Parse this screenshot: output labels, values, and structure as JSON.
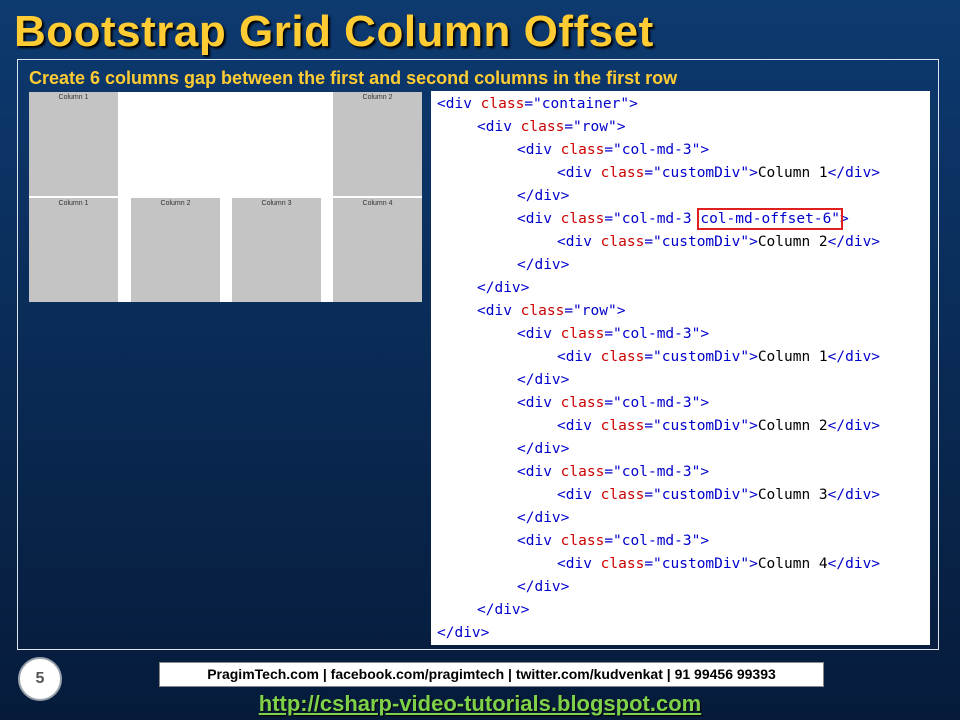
{
  "slide": {
    "title": "Bootstrap Grid Column Offset",
    "subtitle": "Create 6 columns gap between the first and second columns in the first row",
    "number": "5"
  },
  "demo": {
    "row1": [
      "Column 1",
      "Column 2"
    ],
    "row2": [
      "Column 1",
      "Column 2",
      "Column 3",
      "Column 4"
    ]
  },
  "code": {
    "lines": [
      {
        "indent": 0,
        "parts": [
          {
            "c": "t",
            "s": "<div "
          },
          {
            "c": "a",
            "s": "class"
          },
          {
            "c": "t",
            "s": "="
          },
          {
            "c": "v",
            "s": "\"container\""
          },
          {
            "c": "t",
            "s": ">"
          }
        ]
      },
      {
        "indent": 1,
        "parts": [
          {
            "c": "t",
            "s": "<div "
          },
          {
            "c": "a",
            "s": "class"
          },
          {
            "c": "t",
            "s": "="
          },
          {
            "c": "v",
            "s": "\"row\""
          },
          {
            "c": "t",
            "s": ">"
          }
        ]
      },
      {
        "indent": 2,
        "parts": [
          {
            "c": "t",
            "s": "<div "
          },
          {
            "c": "a",
            "s": "class"
          },
          {
            "c": "t",
            "s": "="
          },
          {
            "c": "v",
            "s": "\"col-md-3\""
          },
          {
            "c": "t",
            "s": ">"
          }
        ]
      },
      {
        "indent": 3,
        "parts": [
          {
            "c": "t",
            "s": "<div "
          },
          {
            "c": "a",
            "s": "class"
          },
          {
            "c": "t",
            "s": "="
          },
          {
            "c": "v",
            "s": "\"customDiv\""
          },
          {
            "c": "t",
            "s": ">"
          },
          {
            "c": "x",
            "s": "Column 1"
          },
          {
            "c": "t",
            "s": "</div>"
          }
        ]
      },
      {
        "indent": 2,
        "parts": [
          {
            "c": "t",
            "s": "</div>"
          }
        ]
      },
      {
        "indent": 2,
        "parts": [
          {
            "c": "t",
            "s": "<div "
          },
          {
            "c": "a",
            "s": "class"
          },
          {
            "c": "t",
            "s": "="
          },
          {
            "c": "v",
            "s": "\"col-md-3 "
          },
          {
            "c": "vh",
            "s": "col-md-offset-6\""
          },
          {
            "c": "t",
            "s": ">"
          }
        ]
      },
      {
        "indent": 3,
        "parts": [
          {
            "c": "t",
            "s": "<div "
          },
          {
            "c": "a",
            "s": "class"
          },
          {
            "c": "t",
            "s": "="
          },
          {
            "c": "v",
            "s": "\"customDiv\""
          },
          {
            "c": "t",
            "s": ">"
          },
          {
            "c": "x",
            "s": "Column 2"
          },
          {
            "c": "t",
            "s": "</div>"
          }
        ]
      },
      {
        "indent": 2,
        "parts": [
          {
            "c": "t",
            "s": "</div>"
          }
        ]
      },
      {
        "indent": 1,
        "parts": [
          {
            "c": "t",
            "s": "</div>"
          }
        ]
      },
      {
        "indent": 1,
        "parts": [
          {
            "c": "t",
            "s": "<div "
          },
          {
            "c": "a",
            "s": "class"
          },
          {
            "c": "t",
            "s": "="
          },
          {
            "c": "v",
            "s": "\"row\""
          },
          {
            "c": "t",
            "s": ">"
          }
        ]
      },
      {
        "indent": 2,
        "parts": [
          {
            "c": "t",
            "s": "<div "
          },
          {
            "c": "a",
            "s": "class"
          },
          {
            "c": "t",
            "s": "="
          },
          {
            "c": "v",
            "s": "\"col-md-3\""
          },
          {
            "c": "t",
            "s": ">"
          }
        ]
      },
      {
        "indent": 3,
        "parts": [
          {
            "c": "t",
            "s": "<div "
          },
          {
            "c": "a",
            "s": "class"
          },
          {
            "c": "t",
            "s": "="
          },
          {
            "c": "v",
            "s": "\"customDiv\""
          },
          {
            "c": "t",
            "s": ">"
          },
          {
            "c": "x",
            "s": "Column 1"
          },
          {
            "c": "t",
            "s": "</div>"
          }
        ]
      },
      {
        "indent": 2,
        "parts": [
          {
            "c": "t",
            "s": "</div>"
          }
        ]
      },
      {
        "indent": 2,
        "parts": [
          {
            "c": "t",
            "s": "<div "
          },
          {
            "c": "a",
            "s": "class"
          },
          {
            "c": "t",
            "s": "="
          },
          {
            "c": "v",
            "s": "\"col-md-3\""
          },
          {
            "c": "t",
            "s": ">"
          }
        ]
      },
      {
        "indent": 3,
        "parts": [
          {
            "c": "t",
            "s": "<div "
          },
          {
            "c": "a",
            "s": "class"
          },
          {
            "c": "t",
            "s": "="
          },
          {
            "c": "v",
            "s": "\"customDiv\""
          },
          {
            "c": "t",
            "s": ">"
          },
          {
            "c": "x",
            "s": "Column 2"
          },
          {
            "c": "t",
            "s": "</div>"
          }
        ]
      },
      {
        "indent": 2,
        "parts": [
          {
            "c": "t",
            "s": "</div>"
          }
        ]
      },
      {
        "indent": 2,
        "parts": [
          {
            "c": "t",
            "s": "<div "
          },
          {
            "c": "a",
            "s": "class"
          },
          {
            "c": "t",
            "s": "="
          },
          {
            "c": "v",
            "s": "\"col-md-3\""
          },
          {
            "c": "t",
            "s": ">"
          }
        ]
      },
      {
        "indent": 3,
        "parts": [
          {
            "c": "t",
            "s": "<div "
          },
          {
            "c": "a",
            "s": "class"
          },
          {
            "c": "t",
            "s": "="
          },
          {
            "c": "v",
            "s": "\"customDiv\""
          },
          {
            "c": "t",
            "s": ">"
          },
          {
            "c": "x",
            "s": "Column 3"
          },
          {
            "c": "t",
            "s": "</div>"
          }
        ]
      },
      {
        "indent": 2,
        "parts": [
          {
            "c": "t",
            "s": "</div>"
          }
        ]
      },
      {
        "indent": 2,
        "parts": [
          {
            "c": "t",
            "s": "<div "
          },
          {
            "c": "a",
            "s": "class"
          },
          {
            "c": "t",
            "s": "="
          },
          {
            "c": "v",
            "s": "\"col-md-3\""
          },
          {
            "c": "t",
            "s": ">"
          }
        ]
      },
      {
        "indent": 3,
        "parts": [
          {
            "c": "t",
            "s": "<div "
          },
          {
            "c": "a",
            "s": "class"
          },
          {
            "c": "t",
            "s": "="
          },
          {
            "c": "v",
            "s": "\"customDiv\""
          },
          {
            "c": "t",
            "s": ">"
          },
          {
            "c": "x",
            "s": "Column 4"
          },
          {
            "c": "t",
            "s": "</div>"
          }
        ]
      },
      {
        "indent": 2,
        "parts": [
          {
            "c": "t",
            "s": "</div>"
          }
        ]
      },
      {
        "indent": 1,
        "parts": [
          {
            "c": "t",
            "s": "</div>"
          }
        ]
      },
      {
        "indent": 0,
        "parts": [
          {
            "c": "t",
            "s": "</div>"
          }
        ]
      }
    ]
  },
  "footer": {
    "contacts": "PragimTech.com | facebook.com/pragimtech  | twitter.com/kudvenkat  | 91 99456 99393",
    "link": "http://csharp-video-tutorials.blogspot.com"
  },
  "colors": {
    "title": "#ffcc33",
    "code_tag": "#0000cc",
    "code_attr": "#cc0000",
    "highlight_box": "#e02020",
    "link": "#7fd14a",
    "demo_cell": "#c4c4c4"
  }
}
